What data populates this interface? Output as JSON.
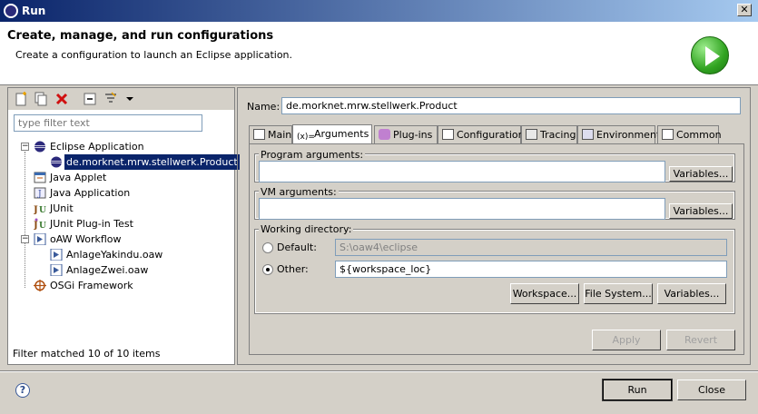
{
  "window": {
    "title": "Run"
  },
  "header": {
    "title": "Create, manage, and run configurations",
    "description": "Create a configuration to launch an Eclipse application."
  },
  "left": {
    "filter_placeholder": "type filter text",
    "tree": [
      {
        "label": "Eclipse Application",
        "icon": "eclipse-icon",
        "expanded": true
      },
      {
        "label": "de.morknet.mrw.stellwerk.Product",
        "icon": "eclipse-icon",
        "selected": true
      },
      {
        "label": "Java Applet",
        "icon": "java-applet-icon"
      },
      {
        "label": "Java Application",
        "icon": "java-application-icon"
      },
      {
        "label": "JUnit",
        "icon": "junit-icon"
      },
      {
        "label": "JUnit Plug-in Test",
        "icon": "junit-plugin-icon"
      },
      {
        "label": "oAW Workflow",
        "icon": "oaw-workflow-icon",
        "expanded": true
      },
      {
        "label": "AnlageYakindu.oaw",
        "icon": "oaw-workflow-icon"
      },
      {
        "label": "AnlageZwei.oaw",
        "icon": "oaw-workflow-icon"
      },
      {
        "label": "OSGi Framework",
        "icon": "osgi-icon"
      }
    ],
    "status": "Filter matched 10 of 10 items"
  },
  "right": {
    "name_label": "Name:",
    "name_value": "de.morknet.mrw.stellwerk.Product",
    "tabs": [
      {
        "label": "Main"
      },
      {
        "label": "Arguments"
      },
      {
        "label": "Plug-ins"
      },
      {
        "label": "Configuration"
      },
      {
        "label": "Tracing"
      },
      {
        "label": "Environment"
      },
      {
        "label": "Common"
      }
    ],
    "program_args_label": "Program arguments:",
    "vm_args_label": "VM arguments:",
    "variables_label": "Variables...",
    "working_dir_label": "Working directory:",
    "default_label": "Default:",
    "default_value": "S:\\oaw4\\eclipse",
    "other_label": "Other:",
    "other_value": "${workspace_loc}",
    "workspace_btn": "Workspace...",
    "filesystem_btn": "File System...",
    "variables_btn": "Variables...",
    "apply_btn": "Apply",
    "revert_btn": "Revert"
  },
  "footer": {
    "run_btn": "Run",
    "close_btn": "Close"
  },
  "colors": {
    "selection": "#0a246a",
    "dialog_bg": "#d4d0c8",
    "run_green": "#31a421"
  }
}
